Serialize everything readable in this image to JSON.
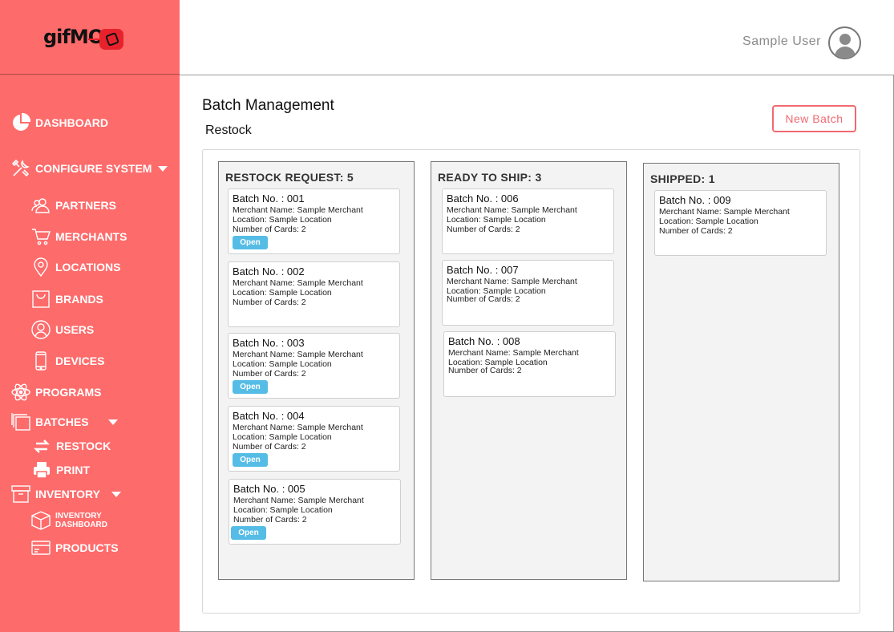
{
  "app": {
    "logo_text": "gifMO"
  },
  "header": {
    "user_name": "Sample User"
  },
  "sidebar": {
    "items": [
      {
        "label": "DASHBOARD",
        "icon": "pie-chart-icon"
      },
      {
        "label": "CONFIGURE SYSTEM",
        "icon": "tools-icon",
        "expanded": true
      },
      {
        "label": "PARTNERS",
        "icon": "users-icon"
      },
      {
        "label": "MERCHANTS",
        "icon": "cart-icon"
      },
      {
        "label": "LOCATIONS",
        "icon": "location-pin-icon"
      },
      {
        "label": "BRANDS",
        "icon": "shopping-bag-icon"
      },
      {
        "label": "USERS",
        "icon": "user-circle-icon"
      },
      {
        "label": "DEVICES",
        "icon": "mobile-device-icon"
      },
      {
        "label": "PROGRAMS",
        "icon": "atom-icon"
      },
      {
        "label": "BATCHES",
        "icon": "layers-icon",
        "expanded": true
      },
      {
        "label": "RESTOCK",
        "icon": "restock-arrows-icon"
      },
      {
        "label": "PRINT",
        "icon": "printer-icon"
      },
      {
        "label": "INVENTORY",
        "icon": "archive-box-icon",
        "expanded": true
      },
      {
        "label": "INVENTORY",
        "label2": "DASHBOARD",
        "icon": "cube-icon"
      },
      {
        "label": "PRODUCTS",
        "icon": "credit-card-icon"
      }
    ]
  },
  "main": {
    "title": "Batch Management",
    "subtitle": "Restock",
    "new_batch_label": "New Batch",
    "open_label": "Open",
    "columns": [
      {
        "title": "RESTOCK REQUEST: 5",
        "cards": [
          {
            "batch": "Batch No. : 001",
            "merchant": "Merchant Name:  Sample Merchant",
            "location": "Location:  Sample Location",
            "cards": "Number of Cards: 2",
            "has_open": true
          },
          {
            "batch": "Batch No. : 002",
            "merchant": "Merchant Name:  Sample Merchant",
            "location": "Location:  Sample Location",
            "cards": "Number of Cards: 2",
            "has_open": false
          },
          {
            "batch": "Batch No. : 003",
            "merchant": "Merchant Name:  Sample Merchant",
            "location": "Location:  Sample Location",
            "cards": "Number of Cards: 2",
            "has_open": true
          },
          {
            "batch": "Batch No. : 004",
            "merchant": "Merchant Name:  Sample Merchant",
            "location": "Location:  Sample Location",
            "cards": "Number of Cards: 2",
            "has_open": true
          },
          {
            "batch": "Batch No. : 005",
            "merchant": "Merchant Name:  Sample Merchant",
            "location": "Location:  Sample Location",
            "cards": "Number of Cards: 2",
            "has_open": true
          }
        ]
      },
      {
        "title": "READY TO SHIP: 3",
        "cards": [
          {
            "batch": "Batch No. : 006",
            "merchant": "Merchant Name:  Sample Merchant",
            "location": "Location:  Sample Location",
            "cards": "Number of Cards: 2",
            "has_open": false
          },
          {
            "batch": "Batch No. : 007",
            "merchant": "Merchant Name:  Sample Merchant",
            "location": "Location:  Sample Location",
            "cards": "Number of Cards: 2",
            "has_open": false
          },
          {
            "batch": "Batch No. : 008",
            "merchant": "Merchant Name:  Sample Merchant",
            "location": "Location:  Sample Location",
            "cards": "Number of Cards: 2",
            "has_open": false
          }
        ]
      },
      {
        "title": "SHIPPED: 1",
        "cards": [
          {
            "batch": "Batch No. : 009",
            "merchant": "Merchant Name:  Sample Merchant",
            "location": "Location:  Sample Location",
            "cards": "Number of Cards: 2",
            "has_open": false
          }
        ]
      }
    ]
  },
  "colors": {
    "sidebar_bg": "#fe6b6b",
    "accent": "#f06a72",
    "open_button": "#55bce6"
  }
}
